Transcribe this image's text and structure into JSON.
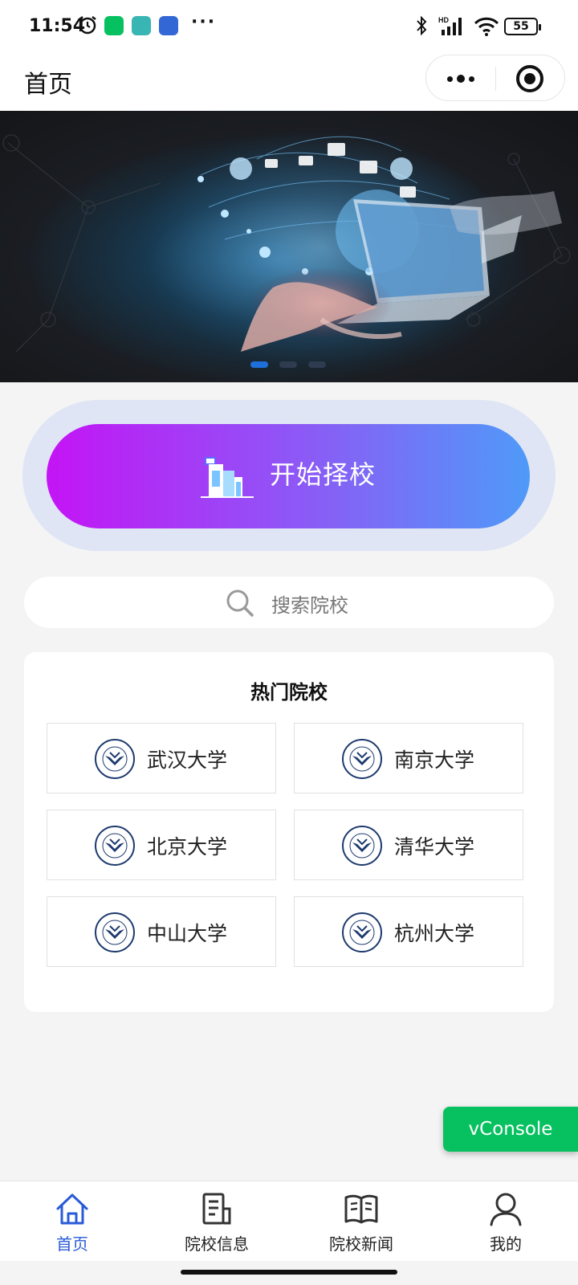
{
  "status_bar": {
    "time": "11:54",
    "battery": "55",
    "more": "···",
    "network": "HD"
  },
  "navbar": {
    "title": "首页"
  },
  "banner": {
    "slide_count": 3,
    "active_index": 0,
    "accent": "#1e6fd9"
  },
  "start_button": {
    "label": "开始择校"
  },
  "search": {
    "placeholder": "搜索院校"
  },
  "hot_schools": {
    "title": "热门院校",
    "items": [
      {
        "name": "武汉大学"
      },
      {
        "name": "南京大学"
      },
      {
        "name": "北京大学"
      },
      {
        "name": "清华大学"
      },
      {
        "name": "中山大学"
      },
      {
        "name": "杭州大学"
      }
    ]
  },
  "vconsole": {
    "label": "vConsole",
    "color": "#07c160"
  },
  "tabbar": {
    "active_color": "#2a5bd7",
    "items": [
      {
        "label": "首页",
        "icon": "home-icon"
      },
      {
        "label": "院校信息",
        "icon": "document-icon"
      },
      {
        "label": "院校新闻",
        "icon": "book-icon"
      },
      {
        "label": "我的",
        "icon": "user-icon"
      }
    ]
  }
}
